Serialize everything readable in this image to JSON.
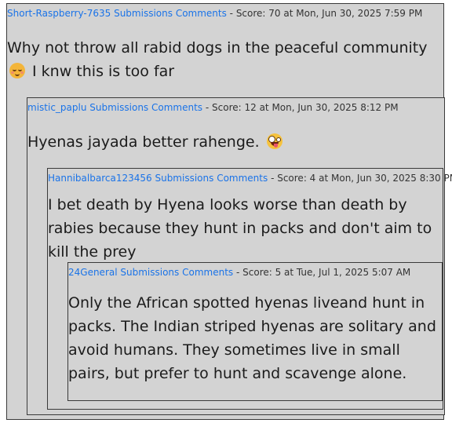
{
  "thread": {
    "comment1": {
      "author": "Short-Raspberry-7635",
      "submissions_label": "Submissions",
      "comments_label": "Comments",
      "meta": " - Score: 70 at Mon, Jun 30, 2025 7:59 PM",
      "body_before_emoji": "Why not throw all rabid dogs in the peaceful community",
      "emoji": "relieved-face",
      "body_after_emoji": " I knw this is too far"
    },
    "comment2": {
      "author": "mistic_paplu",
      "submissions_label": "Submissions",
      "comments_label": "Comments",
      "meta": " - Score: 12 at Mon, Jun 30, 2025 8:12 PM",
      "body_before_emoji": "Hyenas jayada better rahenge.",
      "emoji": "zany-face"
    },
    "comment3": {
      "author": "Hannibalbarca123456",
      "submissions_label": "Submissions",
      "comments_label": "Comments",
      "meta": " - Score: 4 at Mon, Jun 30, 2025 8:30 PM",
      "body": "I bet death by Hyena looks worse than death by rabies because they hunt in packs and don't aim to kill the prey"
    },
    "comment4": {
      "author": "24General",
      "submissions_label": "Submissions",
      "comments_label": "Comments",
      "meta": " - Score: 5 at Tue, Jul 1, 2025 5:07 AM",
      "body": "Only the African spotted hyenas liveand hunt in packs. The Indian striped hyenas are solitary and avoid humans. They sometimes live in small pairs, but prefer to hunt and scavenge alone."
    }
  },
  "colors": {
    "background": "#d3d3d3",
    "link": "#1a73e8",
    "border": "#3a3a3a",
    "text": "#1b1b1b"
  }
}
